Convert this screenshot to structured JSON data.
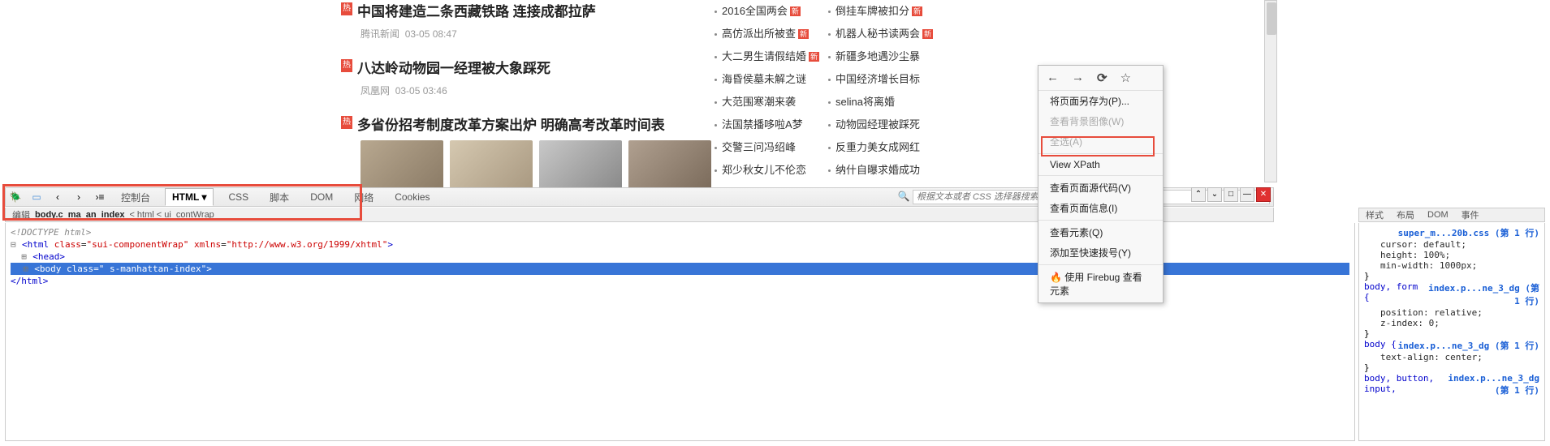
{
  "news": {
    "items": [
      {
        "title": "中国将建造二条西藏铁路 连接成都拉萨",
        "source": "腾讯新闻",
        "time": "03-05 08:47"
      },
      {
        "title": "八达岭动物园一经理被大象踩死",
        "source": "凤凰网",
        "time": "03-05 03:46"
      },
      {
        "title": "多省份招考制度改革方案出炉 明确高考改革时间表",
        "source": "",
        "time": ""
      }
    ],
    "hot_badge": "热"
  },
  "right_cols": {
    "left": [
      {
        "t": "2016全国两会",
        "new": true
      },
      {
        "t": "高仿派出所被查",
        "new": true
      },
      {
        "t": "大二男生请假结婚",
        "new": true
      },
      {
        "t": "海昏侯墓未解之谜",
        "new": false
      },
      {
        "t": "大范围寒潮来袭",
        "new": false
      },
      {
        "t": "法国禁播哆啦A梦",
        "new": false
      },
      {
        "t": "交警三问冯绍峰",
        "new": false
      },
      {
        "t": "郑少秋女儿不伦恋",
        "new": false
      }
    ],
    "right": [
      {
        "t": "倒挂车牌被扣分",
        "new": true
      },
      {
        "t": "机器人秘书读两会",
        "new": true
      },
      {
        "t": "新疆多地遇沙尘暴",
        "new": false
      },
      {
        "t": "中国经济增长目标",
        "new": false
      },
      {
        "t": "selina将离婚",
        "new": false
      },
      {
        "t": "动物园经理被踩死",
        "new": false
      },
      {
        "t": "反重力美女成网红",
        "new": false
      },
      {
        "t": "纳什自曝求婚成功",
        "new": false
      }
    ],
    "new_label": "新"
  },
  "context_menu": {
    "save_as": "将页面另存为(P)...",
    "view_bg": "查看背景图像(W)",
    "select_all": "全选(A)",
    "view_xpath": "View XPath",
    "view_source": "查看页面源代码(V)",
    "view_info": "查看页面信息(I)",
    "inspect": "查看元素(Q)",
    "add_speed": "添加至快速拨号(Y)",
    "firebug_inspect": "使用 Firebug 查看元素"
  },
  "firebug": {
    "tabs": {
      "console": "控制台",
      "html": "HTML",
      "css": "CSS",
      "script": "脚本",
      "dom": "DOM",
      "net": "网络",
      "cookies": "Cookies"
    },
    "search_placeholder": "根据文本或者 CSS 选择器搜索",
    "breadcrumb": {
      "edit": "编辑",
      "path": "body.c_ma_an_index",
      "trail": "< html < ui_contWrap"
    },
    "right_tabs": {
      "style": "样式",
      "layout": "布局",
      "dom": "DOM",
      "event": "事件"
    },
    "html_panel": {
      "doctype": "<!DOCTYPE html>",
      "html_open": "<html class=\"sui-componentWrap\" xmlns=\"http://www.w3.org/1999/xhtml\">",
      "head": "<head>",
      "body": "<body class=\" s-manhattan-index\">",
      "html_close": "</html>"
    },
    "css_panel": {
      "src1": "super_m...20b.css (第 1 行)",
      "rule1_props": [
        "cursor: default;",
        "height: 100%;",
        "min-width: 1000px;"
      ],
      "src2": "index.p...ne_3_dg (第 1 行)",
      "rule2_sel": "body, form {",
      "rule2_props": [
        "position: relative;",
        "z-index: 0;"
      ],
      "src3": "index.p...ne_3_dg (第 1 行)",
      "rule3_sel": "body {",
      "rule3_props": [
        "text-align: center;"
      ],
      "src4": "index.p...ne_3_dg (第 1 行)",
      "rule4_sel": "body, button, input, "
    }
  }
}
